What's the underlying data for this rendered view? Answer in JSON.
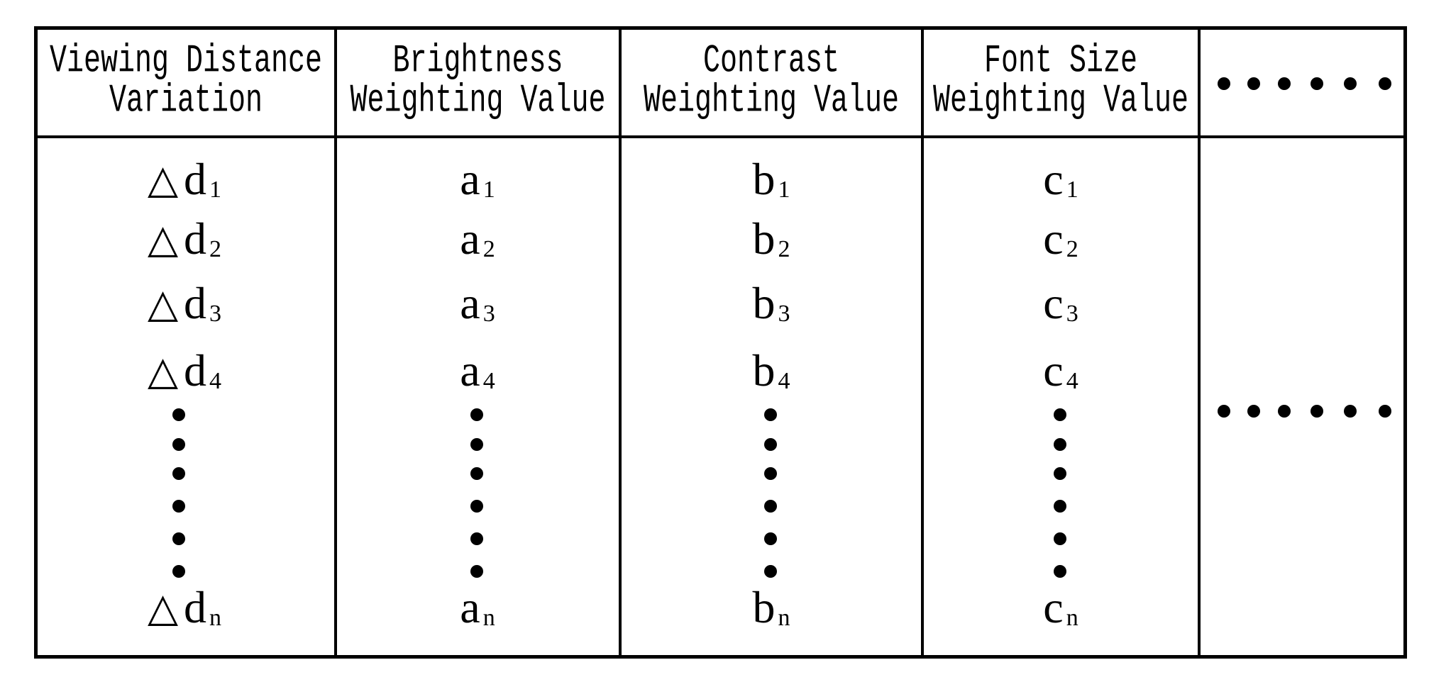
{
  "table": {
    "headers": [
      {
        "line1": "Viewing Distance",
        "line2": "Variation"
      },
      {
        "line1": "Brightness",
        "line2": "Weighting Value"
      },
      {
        "line1": "Contrast",
        "line2": "Weighting Value"
      },
      {
        "line1": "Font Size",
        "line2": "Weighting Value"
      },
      {
        "ellipsis": "••••••"
      }
    ],
    "delta_symbol": "△",
    "rows": [
      {
        "d": "d",
        "d_sub": "1",
        "a": "a",
        "a_sub": "1",
        "b": "b",
        "b_sub": "1",
        "c": "c",
        "c_sub": "1"
      },
      {
        "d": "d",
        "d_sub": "2",
        "a": "a",
        "a_sub": "2",
        "b": "b",
        "b_sub": "2",
        "c": "c",
        "c_sub": "2"
      },
      {
        "d": "d",
        "d_sub": "3",
        "a": "a",
        "a_sub": "3",
        "b": "b",
        "b_sub": "3",
        "c": "c",
        "c_sub": "3"
      },
      {
        "d": "d",
        "d_sub": "4",
        "a": "a",
        "a_sub": "4",
        "b": "b",
        "b_sub": "4",
        "c": "c",
        "c_sub": "4"
      },
      {
        "d": "d",
        "d_sub": "n",
        "a": "a",
        "a_sub": "n",
        "b": "b",
        "b_sub": "n",
        "c": "c",
        "c_sub": "n"
      }
    ],
    "vertical_ellipsis_dot_count": 6,
    "horizontal_ellipsis_dot_count": 6
  }
}
